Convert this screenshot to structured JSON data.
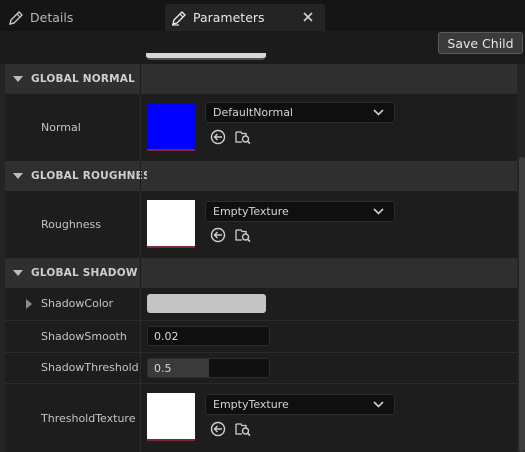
{
  "tabs": {
    "details": {
      "label": "Details",
      "icon": "pencil-icon"
    },
    "parameters": {
      "label": "Parameters",
      "icon": "pencil-icon",
      "close_icon": "close-icon"
    }
  },
  "toolbar": {
    "save_child_label": "Save Child"
  },
  "categories": {
    "global_normal": {
      "title": "GLOBAL NORMAL",
      "normal": {
        "label": "Normal",
        "thumbnail_color": "#0000ff",
        "texture": "DefaultNormal"
      }
    },
    "global_roughness": {
      "title": "GLOBAL ROUGHNESS",
      "roughness": {
        "label": "Roughness",
        "thumbnail_color": "#ffffff",
        "texture": "EmptyTexture"
      }
    },
    "global_shadow": {
      "title": "GLOBAL SHADOW",
      "shadow_color": {
        "label": "ShadowColor",
        "color": "#c4c4c4"
      },
      "shadow_smooth": {
        "label": "ShadowSmooth",
        "value": "0.02"
      },
      "shadow_threshold": {
        "label": "ShadowThreshold",
        "value": "0.5",
        "slider_fraction": 0.5
      },
      "threshold_texture": {
        "label": "ThresholdTexture",
        "thumbnail_color": "#ffffff",
        "texture": "EmptyTexture"
      }
    }
  },
  "colors": {
    "panel_bg": "#242424",
    "row_bg": "#1d1d1d",
    "category_bg": "#2f2f2f",
    "thumb_underline": "#7a2a35"
  }
}
